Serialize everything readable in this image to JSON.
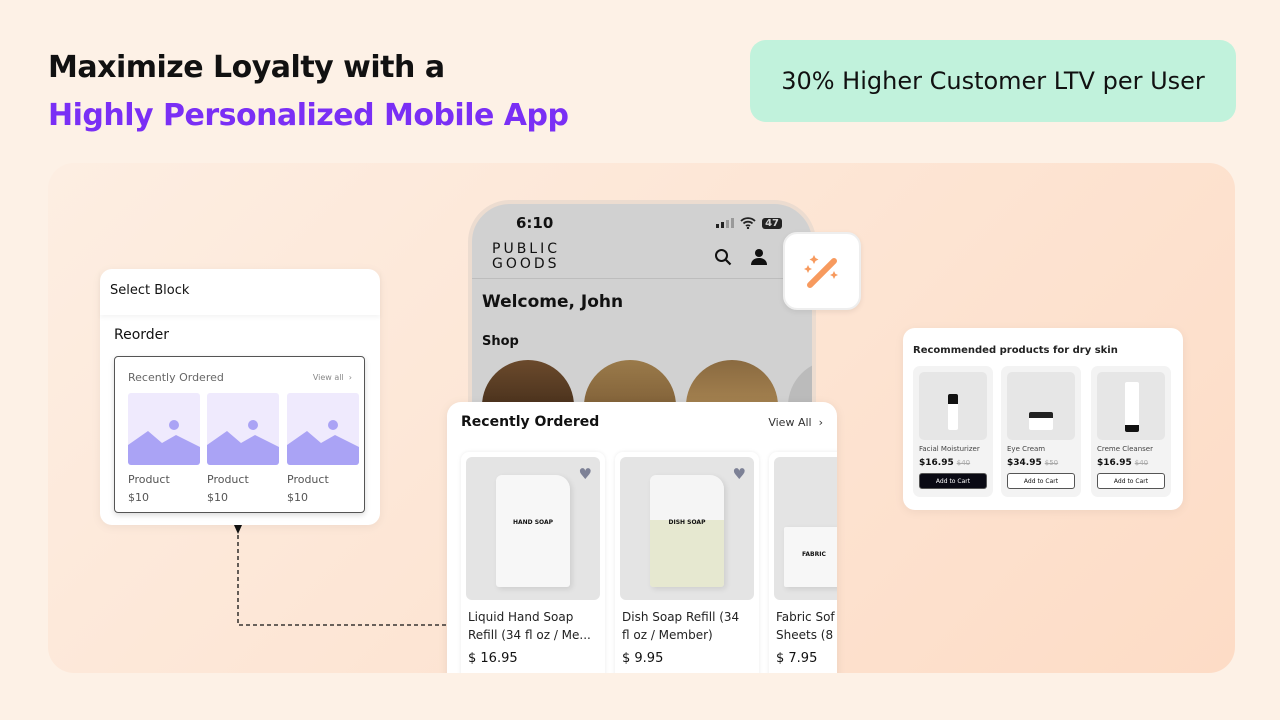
{
  "headline": {
    "line1": "Maximize Loyalty with a",
    "line2": "Highly Personalized Mobile App"
  },
  "badge": "30% Higher Customer LTV per User",
  "colors": {
    "accent": "#7a2ff5",
    "badge_bg": "#c1f2dc",
    "magic_icon": "#f79a5e"
  },
  "phone": {
    "time": "6:10",
    "battery": "47",
    "logo_line1": "PUBLIC",
    "logo_line2": "GOODS",
    "welcome": "Welcome, John",
    "shop": "Shop",
    "icons": [
      "search-icon",
      "user-icon",
      "signal-icon",
      "wifi-icon",
      "battery-icon"
    ]
  },
  "magic_button": {
    "icon": "magic-wand-icon"
  },
  "select_block": {
    "title": "Select Block",
    "section": "Reorder",
    "preview_title": "Recently Ordered",
    "view_all": "View all",
    "items": [
      {
        "name": "Product",
        "price": "$10"
      },
      {
        "name": "Product",
        "price": "$10"
      },
      {
        "name": "Product",
        "price": "$10"
      }
    ]
  },
  "recently_ordered": {
    "title": "Recently Ordered",
    "view_all": "View All",
    "items": [
      {
        "name1": "Liquid Hand Soap",
        "name2": "Refill (34 fl oz / Me...",
        "price": "$ 16.95",
        "label": "HAND SOAP"
      },
      {
        "name1": "Dish Soap Refill (34",
        "name2": "fl oz / Member)",
        "price": "$ 9.95",
        "label": "DISH SOAP"
      },
      {
        "name1": "Fabric Sof",
        "name2": "Sheets (8",
        "price": "$ 7.95",
        "label": "FABRIC"
      }
    ]
  },
  "recommended": {
    "title": "Recommended products for dry skin",
    "items": [
      {
        "name": "Facial Moisturizer",
        "price": "$16.95",
        "old_price": "$40",
        "button": "Add to Cart"
      },
      {
        "name": "Eye Cream",
        "price": "$34.95",
        "old_price": "$50",
        "button": "Add to Cart"
      },
      {
        "name": "Creme Cleanser",
        "price": "$16.95",
        "old_price": "$40",
        "button": "Add to Cart"
      }
    ]
  }
}
